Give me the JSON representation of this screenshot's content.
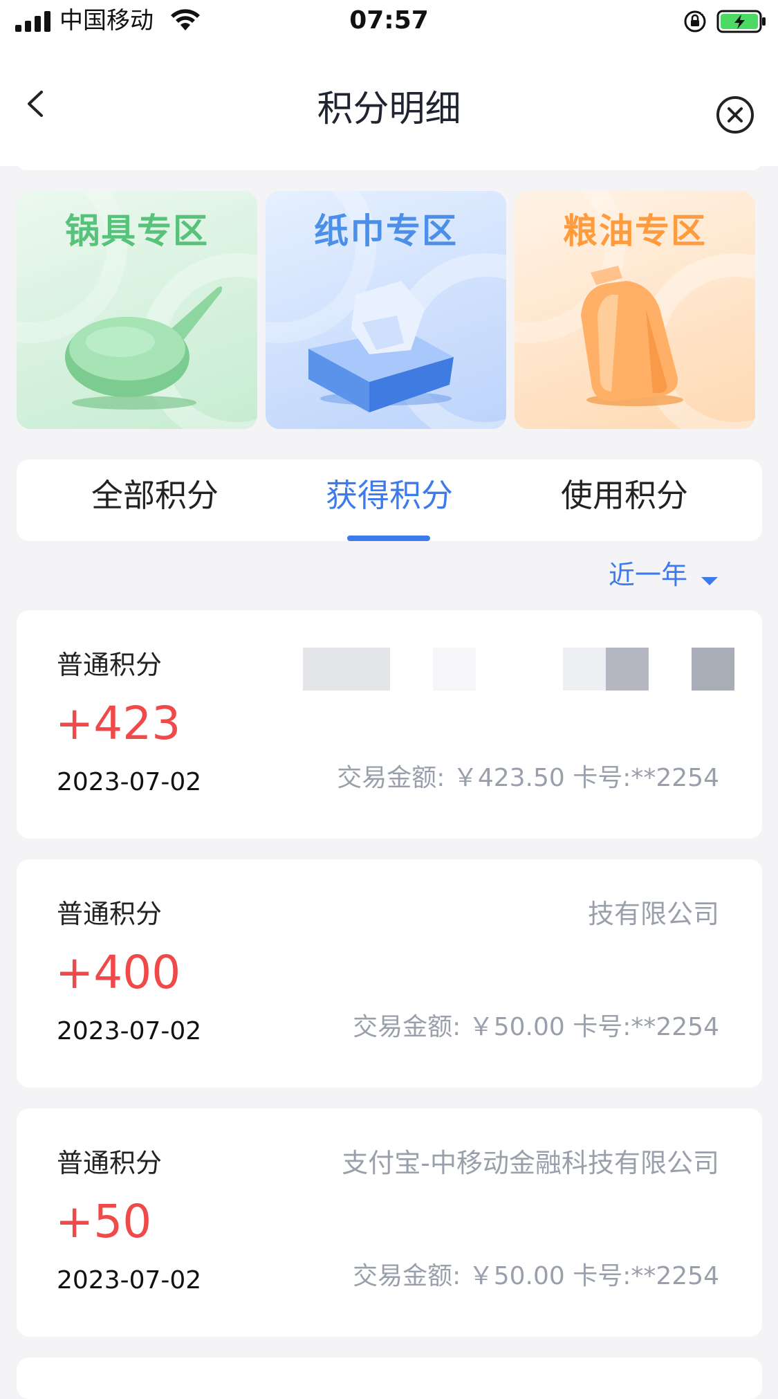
{
  "status_bar": {
    "carrier": "中国移动",
    "time": "07:57"
  },
  "nav": {
    "title": "积分明细"
  },
  "categories": [
    {
      "label": "锅具专区",
      "color": "#56c27a"
    },
    {
      "label": "纸巾专区",
      "color": "#4b8fe8"
    },
    {
      "label": "粮油专区",
      "color": "#ff9b3d"
    }
  ],
  "tabs": {
    "all": "全部积分",
    "earn": "获得积分",
    "use": "使用积分",
    "active": "获得积分"
  },
  "filter": {
    "label": "近一年"
  },
  "records": [
    {
      "type": "普通积分",
      "merchant": "",
      "points": "+423",
      "date": "2023-07-02",
      "amount": "交易金额: ￥423.50  卡号:**2254"
    },
    {
      "type": "普通积分",
      "merchant": "技有限公司",
      "points": "+400",
      "date": "2023-07-02",
      "amount": "交易金额: ￥50.00  卡号:**2254"
    },
    {
      "type": "普通积分",
      "merchant": "支付宝-中移动金融科技有限公司",
      "points": "+50",
      "date": "2023-07-02",
      "amount": "交易金额: ￥50.00  卡号:**2254"
    }
  ],
  "colors": {
    "accent": "#3d7bed",
    "points": "#f0494a",
    "muted": "#9aa0ab",
    "background": "#f4f4f6"
  }
}
